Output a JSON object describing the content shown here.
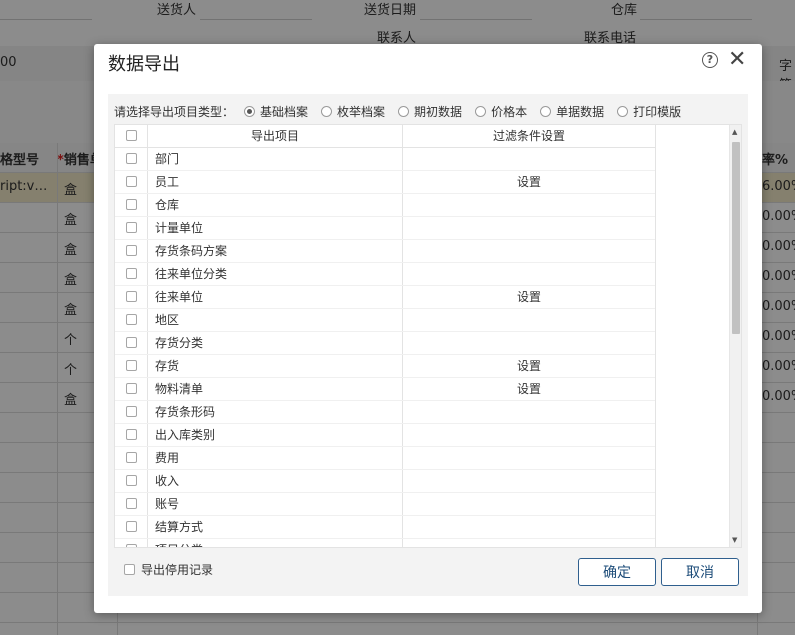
{
  "background": {
    "labels": {
      "deliverer": "送货人",
      "delivery_date": "送货日期",
      "warehouse": "仓库",
      "contact": "联系人",
      "contact_phone": "联系电话",
      "field_value": "00",
      "char_label": "字符"
    },
    "table": {
      "col_model": "格型号",
      "col_unit": "销售单",
      "col_rate": "率%",
      "first_cell": "ript:v…",
      "units": [
        "盒",
        "盒",
        "盒",
        "盒",
        "盒",
        "个",
        "个",
        "盒"
      ],
      "rates": [
        "6.00%",
        "0.00%",
        "0.00%",
        "0.00%",
        "0.00%",
        "0.00%",
        "0.00%",
        "0.00%"
      ]
    }
  },
  "dialog": {
    "title": "数据导出",
    "help_glyph": "?",
    "close_glyph": "✕",
    "type_prompt": "请选择导出项目类型：",
    "types": [
      {
        "label": "基础档案",
        "selected": true
      },
      {
        "label": "枚举档案",
        "selected": false
      },
      {
        "label": "期初数据",
        "selected": false
      },
      {
        "label": "价格本",
        "selected": false
      },
      {
        "label": "单据数据",
        "selected": false
      },
      {
        "label": "打印模版",
        "selected": false
      }
    ],
    "grid": {
      "col_item": "导出项目",
      "col_filter": "过滤条件设置",
      "rows": [
        {
          "name": "部门",
          "filter": ""
        },
        {
          "name": "员工",
          "filter": "设置"
        },
        {
          "name": "仓库",
          "filter": ""
        },
        {
          "name": "计量单位",
          "filter": ""
        },
        {
          "name": "存货条码方案",
          "filter": ""
        },
        {
          "name": "往来单位分类",
          "filter": ""
        },
        {
          "name": "往来单位",
          "filter": "设置"
        },
        {
          "name": "地区",
          "filter": ""
        },
        {
          "name": "存货分类",
          "filter": ""
        },
        {
          "name": "存货",
          "filter": "设置"
        },
        {
          "name": "物料清单",
          "filter": "设置"
        },
        {
          "name": "存货条形码",
          "filter": ""
        },
        {
          "name": "出入库类别",
          "filter": ""
        },
        {
          "name": "费用",
          "filter": ""
        },
        {
          "name": "收入",
          "filter": ""
        },
        {
          "name": "账号",
          "filter": ""
        },
        {
          "name": "结算方式",
          "filter": ""
        },
        {
          "name": "项目分类",
          "filter": ""
        }
      ]
    },
    "export_disabled_label": "导出停用记录",
    "ok_label": "确定",
    "cancel_label": "取消"
  }
}
